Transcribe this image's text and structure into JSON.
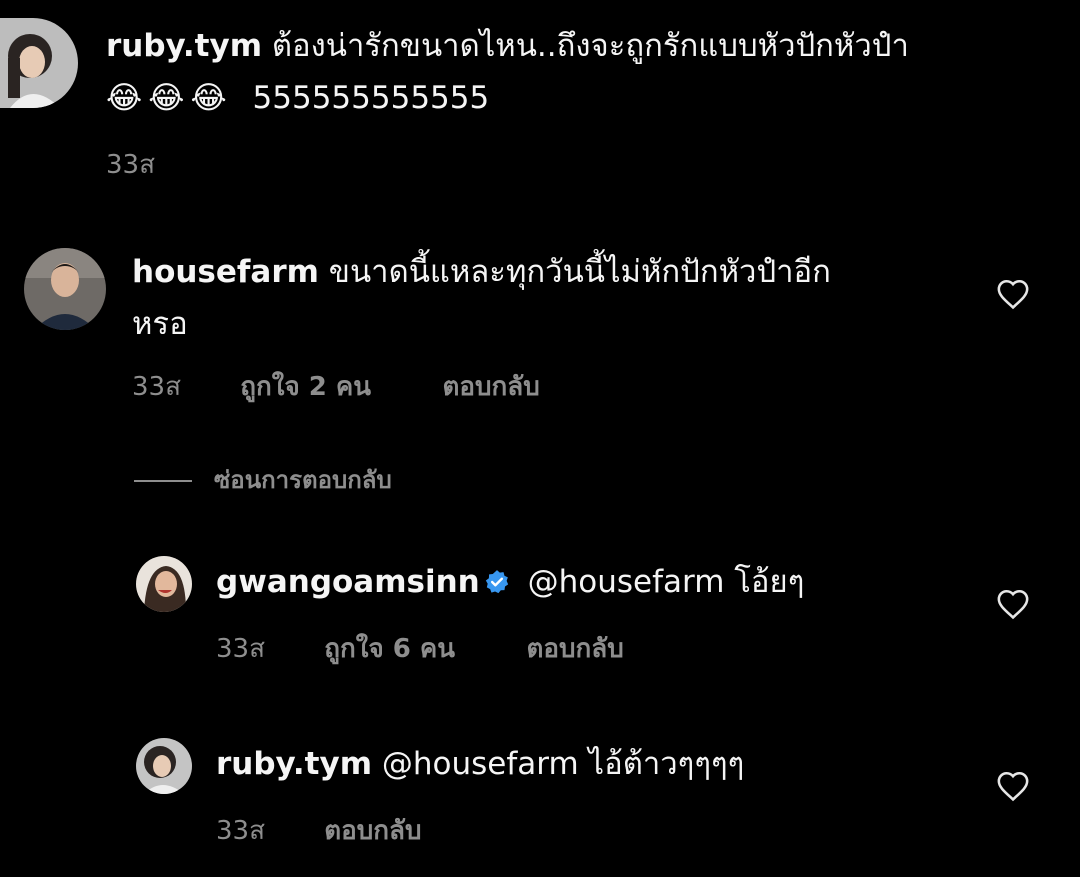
{
  "comments": [
    {
      "username": "ruby.tym",
      "text_line1": "ต้องน่ารักขนาดไหน..ถึงจะถูกรักแบบหัวปักหัวปำ",
      "emoji": "😂😂😂",
      "text_line2": "555555555555",
      "time": "33ส"
    },
    {
      "username": "housefarm",
      "text_line1": "ขนาดนี้แหละทุกวันนี้ไม่หักปักหัวปำอีก",
      "text_line2": "หรอ",
      "time": "33ส",
      "likes": "ถูกใจ 2 คน",
      "reply": "ตอบกลับ"
    }
  ],
  "hide_replies": "ซ่อนการตอบกลับ",
  "replies": [
    {
      "username": "gwangoamsinn",
      "verified": true,
      "mention": "@housefarm",
      "text": "โอ้ยๆ",
      "time": "33ส",
      "likes": "ถูกใจ 6 คน",
      "reply": "ตอบกลับ"
    },
    {
      "username": "ruby.tym",
      "mention": "@housefarm",
      "text": "ไอ้ต้าวๆๆๆๆ",
      "time": "33ส",
      "reply": "ตอบกลับ"
    }
  ],
  "colors": {
    "background": "#000000",
    "text": "#f5f5f5",
    "muted": "#8e8e8e",
    "verified": "#3897f0"
  },
  "icons": [
    "heart-outline-icon",
    "verified-badge-icon"
  ]
}
